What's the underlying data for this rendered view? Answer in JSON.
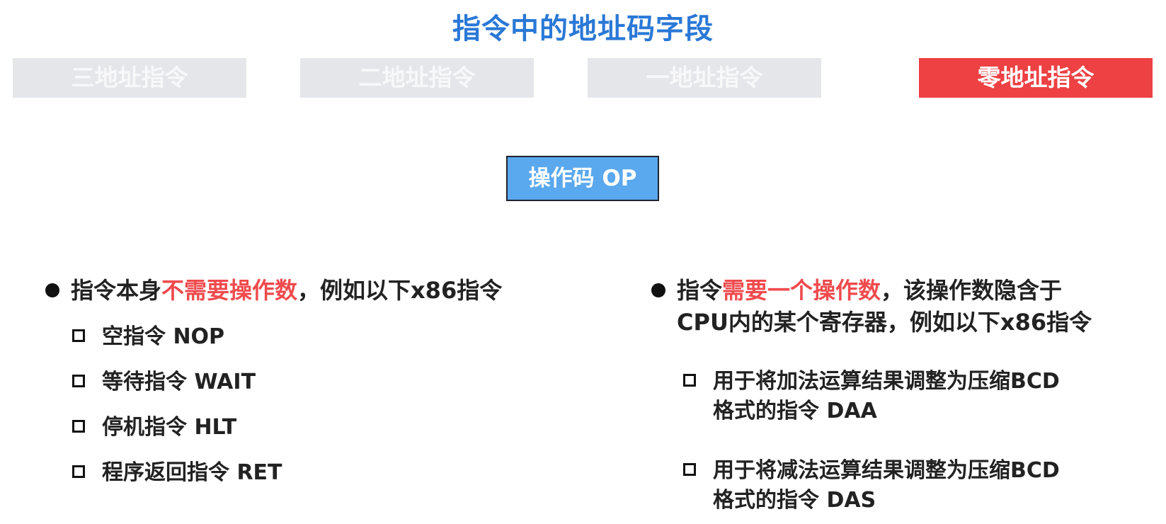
{
  "title": "指令中的地址码字段",
  "tabs": [
    {
      "label": "三地址指令",
      "active": false
    },
    {
      "label": "二地址指令",
      "active": false
    },
    {
      "label": "一地址指令",
      "active": false
    },
    {
      "label": "零地址指令",
      "active": true
    }
  ],
  "opcode_box": "操作码 OP",
  "left": {
    "bullet_pre": "指令本身",
    "bullet_highlight": "不需要操作数",
    "bullet_post": "，例如以下x86指令",
    "items": [
      "空指令 NOP",
      "等待指令 WAIT",
      "停机指令 HLT",
      "程序返回指令 RET"
    ]
  },
  "right": {
    "bullet_pre": "指令",
    "bullet_highlight": "需要一个操作数",
    "bullet_post": "，该操作数隐含于",
    "bullet_line2": "CPU内的某个寄存器，例如以下x86指令",
    "items": [
      {
        "line1": "用于将加法运算结果调整为压缩BCD",
        "line2": "格式的指令 DAA"
      },
      {
        "line1": "用于将减法运算结果调整为压缩BCD",
        "line2": "格式的指令 DAS"
      }
    ]
  },
  "colors": {
    "title": "#2a78d6",
    "tab_inactive": "#e5e6ea",
    "tab_active": "#ed4144",
    "opcode_box": "#5aa8ee",
    "highlight": "#ef4a4d"
  }
}
